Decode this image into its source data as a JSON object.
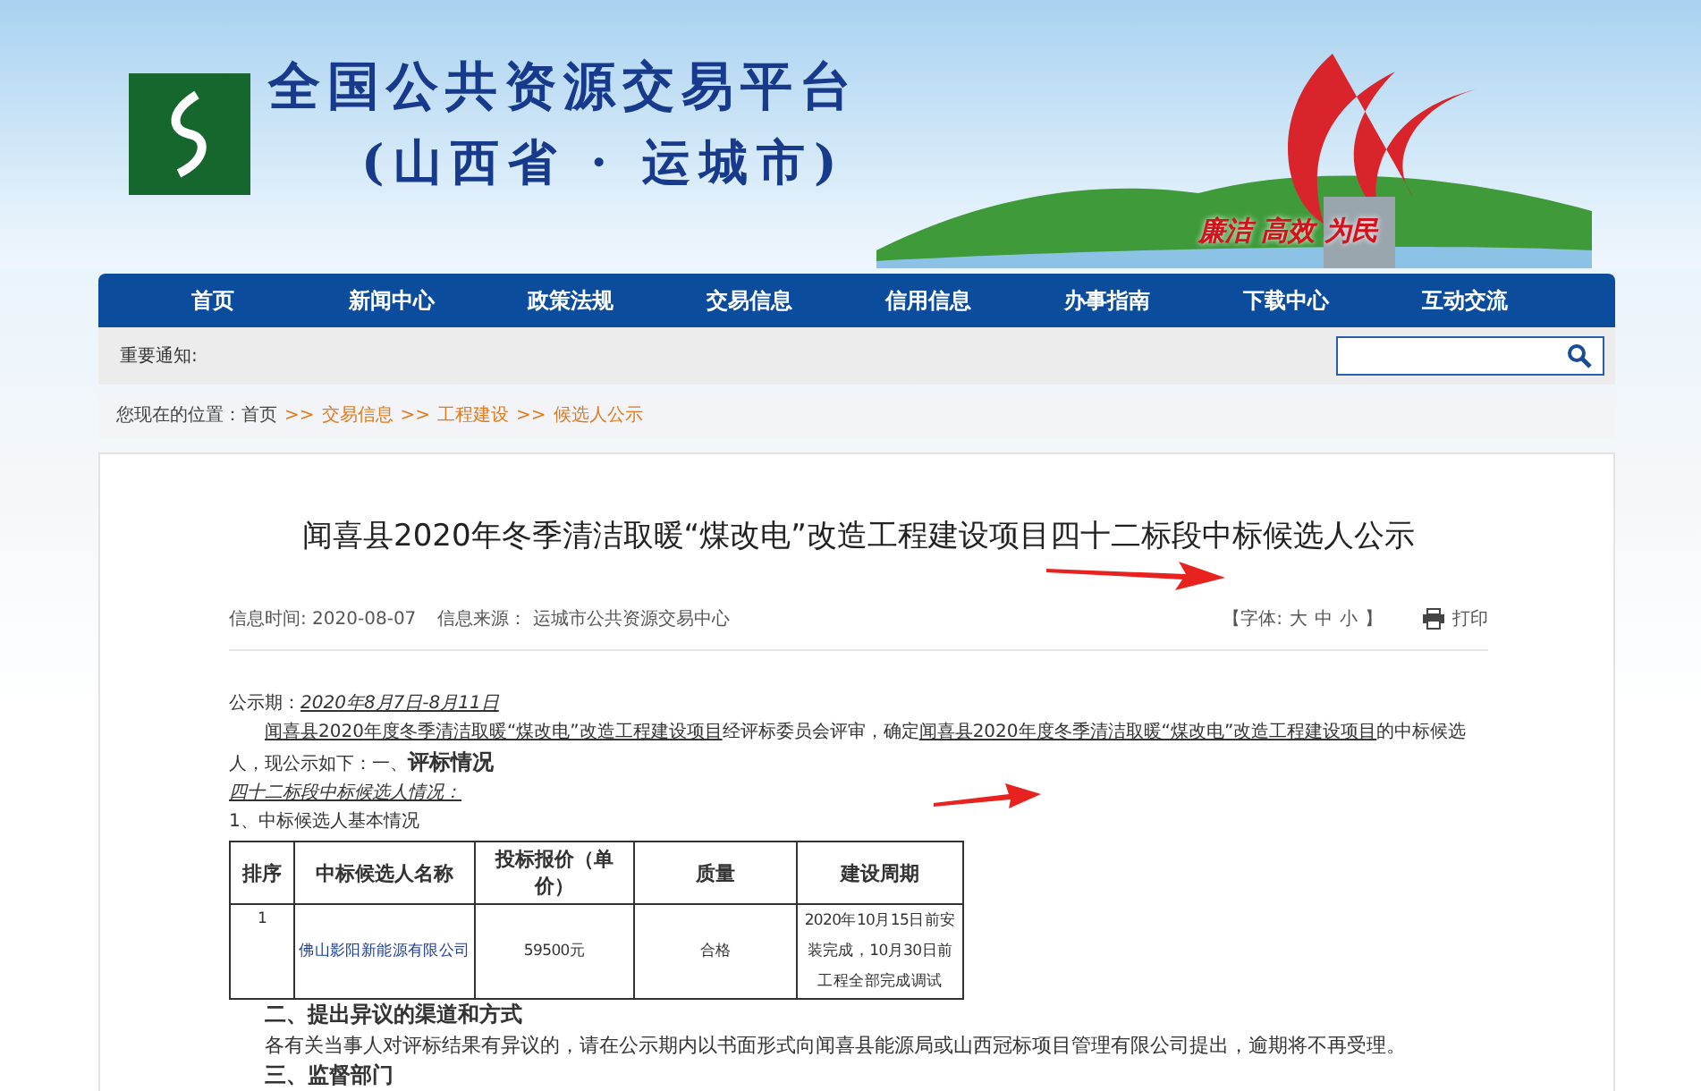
{
  "header": {
    "title_line1": "全国公共资源交易平台",
    "title_line2": "(山西省 · 运城市)",
    "slogan": "廉洁 高效 为民"
  },
  "nav": {
    "items": [
      {
        "label": "首页"
      },
      {
        "label": "新闻中心"
      },
      {
        "label": "政策法规"
      },
      {
        "label": "交易信息"
      },
      {
        "label": "信用信息"
      },
      {
        "label": "办事指南"
      },
      {
        "label": "下载中心"
      },
      {
        "label": "互动交流"
      }
    ]
  },
  "notice": {
    "label": "重要通知:"
  },
  "breadcrumb": {
    "prefix": "您现在的位置：首页",
    "links": [
      {
        "separator": ">>",
        "label": "交易信息"
      },
      {
        "separator": ">>",
        "label": "工程建设"
      },
      {
        "separator": ">>",
        "label": "候选人公示"
      }
    ]
  },
  "article": {
    "title": "闻喜县2020年冬季清洁取暖“煤改电”改造工程建设项目四十二标段中标候选人公示",
    "meta": {
      "time": "信息时间: 2020-08-07",
      "source": "信息来源： 运城市公共资源交易中心",
      "font_open": "【字体:",
      "font_sizes": [
        "大",
        "中",
        "小"
      ],
      "font_close": "】",
      "print": "打印"
    },
    "period_label": "公示期：",
    "period": "2020年8月7日-8月11日",
    "intro": [
      {
        "kind": "underline",
        "text": "闻喜县2020年度冬季清洁取暖“煤改电”改造工程建设项目"
      },
      {
        "kind": "plain",
        "text": "经评标委员会评审，确定"
      },
      {
        "kind": "underline",
        "text": "闻喜县2020年度冬季清洁取暖“煤改电”改造工程建设项目"
      },
      {
        "kind": "plain",
        "text": "的中标候选人，现公示如下：一、"
      },
      {
        "kind": "bold",
        "text": "评标情况"
      }
    ],
    "lot_heading": "四十二标段中标候选人情况：",
    "table_caption": "1、中标候选人基本情况",
    "table": {
      "columns": [
        "排序",
        "中标候选人名称",
        "投标报价（单价）",
        "质量",
        "建设周期"
      ],
      "rows": [
        [
          "1",
          "佛山影阳新能源有限公司",
          "59500元",
          "合格",
          "2020年10月15日前安装完成，10月30日前工程全部完成调试"
        ]
      ]
    },
    "section2_heading": "二、提出异议的渠道和方式",
    "section2_text": "各有关当事人对评标结果有异议的，请在公示期内以书面形式向闻喜县能源局或山西冠标项目管理有限公司提出，逾期将不再受理。",
    "section3_heading": "三、监督部门"
  }
}
